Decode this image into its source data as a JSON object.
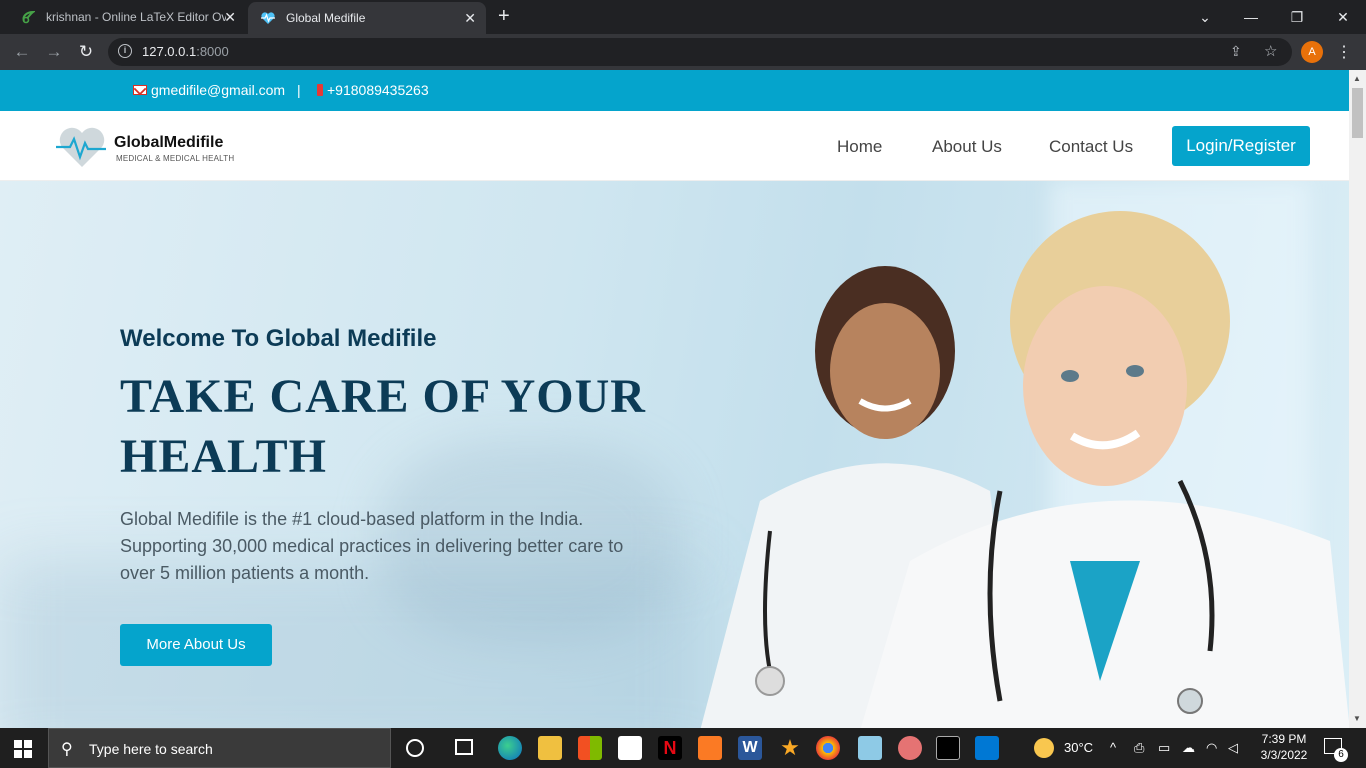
{
  "browser": {
    "tabs": [
      {
        "title": "krishnan - Online LaTeX Editor Ov",
        "close": "✕"
      },
      {
        "title": "Global Medifile",
        "close": "✕",
        "active": true
      }
    ],
    "new_tab": "+",
    "url_host": "127.0.0.1",
    "url_port": ":8000",
    "profile_initial": "A"
  },
  "topbar": {
    "email": "gmedifile@gmail.com",
    "separator": "|",
    "phone": "+918089435263"
  },
  "header": {
    "brand": "GlobalMedifile",
    "tagline": "MEDICAL & MEDICAL HEALTH",
    "nav": [
      "Home",
      "About Us",
      "Contact Us"
    ],
    "login": "Login/Register"
  },
  "hero": {
    "welcome": "Welcome To Global Medifile",
    "headline_line1": "TAKE CARE OF YOUR",
    "headline_line2": "HEALTH",
    "description": "Global Medifile is the #1 cloud-based platform in the India. Supporting 30,000 medical practices in delivering better care to over 5 million patients a month.",
    "cta": "More About Us"
  },
  "taskbar": {
    "search_placeholder": "Type here to search",
    "weather": "30°C",
    "time": "7:39 PM",
    "date": "3/3/2022",
    "notifications": "6"
  },
  "colors": {
    "accent": "#05a4cc",
    "heading": "#0c3b56"
  }
}
